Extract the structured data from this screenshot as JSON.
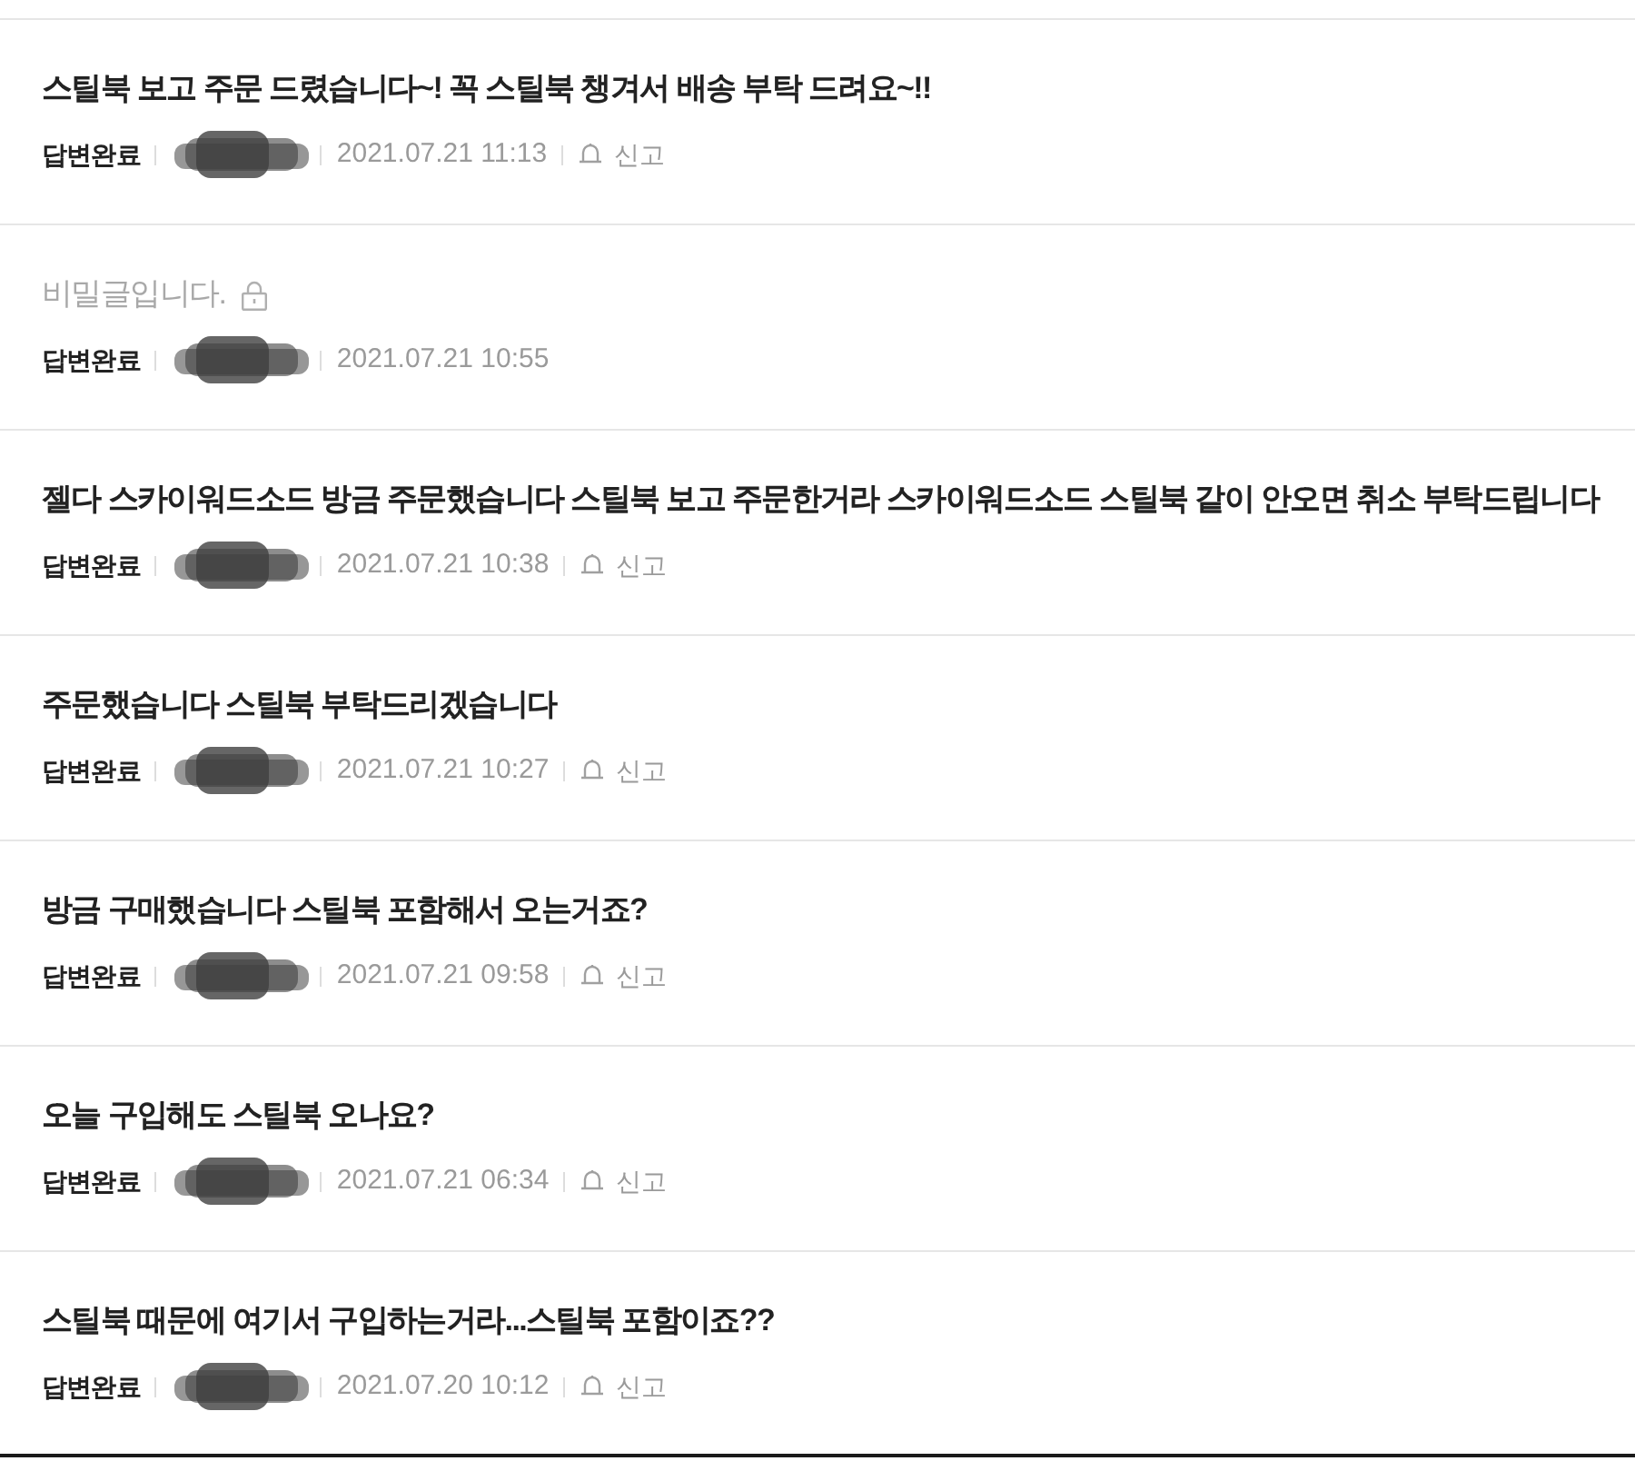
{
  "posts": [
    {
      "title": "스틸북 보고 주문 드렸습니다~! 꼭 스틸북 챙겨서 배송 부탁 드려요~!!",
      "secret": false,
      "status": "답변완료",
      "date": "2021.07.21 11:13",
      "report": "신고"
    },
    {
      "title": "비밀글입니다.",
      "secret": true,
      "status": "답변완료",
      "date": "2021.07.21 10:55"
    },
    {
      "title": "젤다 스카이워드소드 방금 주문했습니다 스틸북 보고 주문한거라 스카이워드소드 스틸북 같이 안오면 취소 부탁드립니다",
      "secret": false,
      "status": "답변완료",
      "date": "2021.07.21 10:38",
      "report": "신고"
    },
    {
      "title": "주문했습니다 스틸북 부탁드리겠습니다",
      "secret": false,
      "status": "답변완료",
      "date": "2021.07.21 10:27",
      "report": "신고"
    },
    {
      "title": "방금 구매했습니다 스틸북 포함해서 오는거죠?",
      "secret": false,
      "status": "답변완료",
      "date": "2021.07.21 09:58",
      "report": "신고"
    },
    {
      "title": "오늘 구입해도 스틸북 오나요?",
      "secret": false,
      "status": "답변완료",
      "date": "2021.07.21 06:34",
      "report": "신고"
    },
    {
      "title": "스틸북 때문에 여기서 구입하는거라...스틸북 포함이죠??",
      "secret": false,
      "status": "답변완료",
      "date": "2021.07.20 10:12",
      "report": "신고"
    }
  ]
}
